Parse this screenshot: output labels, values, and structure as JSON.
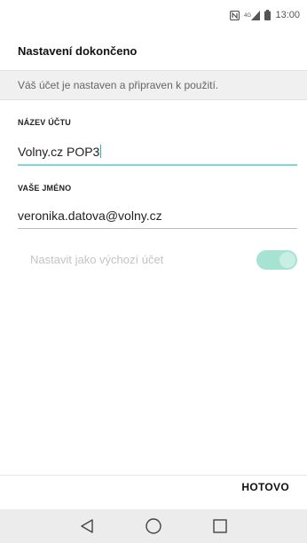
{
  "status_bar": {
    "time": "13:00",
    "icons": [
      "nfc-icon",
      "signal-icon",
      "battery-icon"
    ]
  },
  "header": {
    "title": "Nastavení dokončeno"
  },
  "info": {
    "message": "Váš účet je nastaven a připraven k použití."
  },
  "fields": {
    "account_name": {
      "label": "NÁZEV ÚČTU",
      "value": "Volny.cz POP3"
    },
    "your_name": {
      "label": "VAŠE JMÉNO",
      "value": "veronika.datova@volny.cz"
    }
  },
  "toggle": {
    "label": "Nastavit jako výchozí účet",
    "enabled": true,
    "color": "#a7e3d3"
  },
  "footer": {
    "done_label": "HOTOVO"
  },
  "nav": {
    "buttons": [
      "back-icon",
      "home-icon",
      "recents-icon"
    ]
  },
  "colors": {
    "accent": "#7fd8d8",
    "info_background": "#f0f0f0",
    "nav_background": "#ececec"
  }
}
